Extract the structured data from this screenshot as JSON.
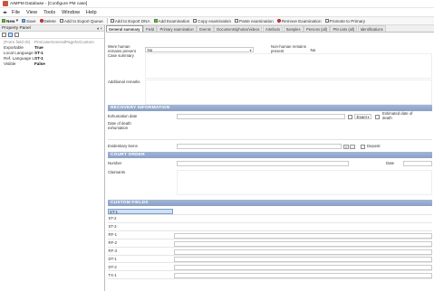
{
  "window": {
    "title": "AIMPM Database - [Configure PM case]"
  },
  "menu": {
    "items": [
      "File",
      "View",
      "Tools",
      "Window",
      "Help"
    ]
  },
  "toolbar": {
    "new_label": "New",
    "save_label": "Save",
    "delete_label": "Delete",
    "add_queue_label": "Add to Export Queue",
    "add_dna_label": "Add to Export DNA",
    "add_exam_label": "Add Examination",
    "copy_exam_label": "Copy examination",
    "paste_exam_label": "Paste examination",
    "remove_exam_label": "Remove Examination",
    "promote_label": "Promote to Primary"
  },
  "property_panel": {
    "title": "Property Panel",
    "pin": "♦ ×",
    "rows": [
      {
        "key": "(Form field ID)",
        "value": "PmCaseGeneralPageforCustom",
        "muted": true
      },
      {
        "key": "Exportable",
        "value": "True",
        "muted": false
      },
      {
        "key": "Local Language Label",
        "value": "ST-1",
        "muted": false
      },
      {
        "key": "Ref. Language Label",
        "value": "ST-1",
        "muted": false
      },
      {
        "key": "Visible",
        "value": "False",
        "muted": false
      }
    ]
  },
  "tabs": [
    {
      "label": "General summary",
      "active": true
    },
    {
      "label": "Field",
      "active": false
    },
    {
      "label": "Primary examination",
      "active": false
    },
    {
      "label": "Events",
      "active": false
    },
    {
      "label": "Documents/photos/videos",
      "active": false
    },
    {
      "label": "Artefacts",
      "active": false
    },
    {
      "label": "Samples",
      "active": false
    },
    {
      "label": "Persons (all)",
      "active": false
    },
    {
      "label": "PM Lists (all)",
      "active": false
    },
    {
      "label": "Identifications",
      "active": false
    }
  ],
  "general": {
    "remains_present_label": "Were human remains present",
    "remains_present_value": "No",
    "non_human_label": "Non-human remains present",
    "non_human_value": "No",
    "case_summary_label": "Case summary",
    "additional_remarks_label": "Additional remarks"
  },
  "recovery": {
    "section_title": "RECOVERY INFORMATION",
    "exhumation_date_label": "Exhumation date",
    "exact_label": "Exact",
    "estimated_label": "Estimated date of death",
    "last_seen_label": "Date of death exhumation",
    "evidentiary_items_label": "Evidentiary items",
    "deposit_label": "Deposit"
  },
  "court": {
    "section_title": "COURT ORDER",
    "number_label": "Number",
    "date_label": "Date",
    "claimants_label": "Claimants"
  },
  "custom": {
    "section_title": "CUSTOM FIELDS",
    "rows": [
      "ST-1",
      "ST-2",
      "ST-3",
      "RF-1",
      "RF-2",
      "RF-3",
      "DT-1",
      "DT-2",
      "TX-1"
    ]
  }
}
